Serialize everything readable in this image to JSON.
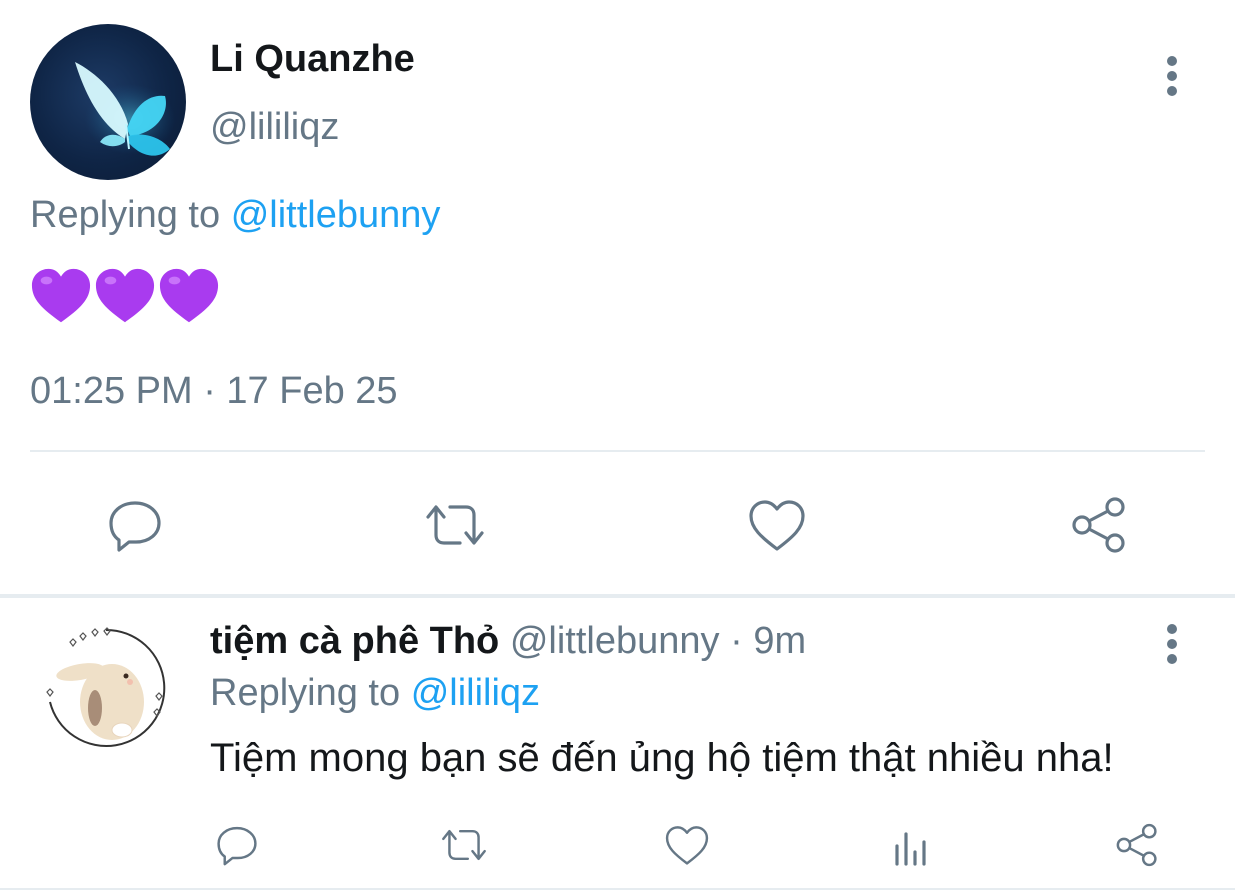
{
  "main_tweet": {
    "author_name": "Li Quanzhe",
    "author_handle": "@lililiqz",
    "avatar_icon": "butterfly-avatar-icon",
    "replying_prefix": "Replying to",
    "replying_to": "@littlebunny",
    "content_emoji": "💜💜💜",
    "timestamp": "01:25 PM · 17 Feb 25",
    "actions": [
      "reply-icon",
      "retweet-icon",
      "like-icon",
      "share-icon"
    ]
  },
  "reply_tweet": {
    "author_name": "tiệm cà phê Thỏ",
    "author_handle": "@littlebunny",
    "separator": "·",
    "time_ago": "9m",
    "avatar_icon": "bunny-avatar-icon",
    "replying_prefix": "Replying to",
    "replying_to": "@lililiqz",
    "content": "Tiệm mong bạn sẽ đến ủng hộ tiệm thật nhiều nha!",
    "actions": [
      "reply-icon",
      "retweet-icon",
      "like-icon",
      "analytics-icon",
      "share-icon"
    ]
  },
  "colors": {
    "primary_text": "#14171a",
    "secondary_text": "#657786",
    "link": "#1da1f2",
    "divider": "#e6ecf0",
    "heart_purple": "#a93bef"
  }
}
